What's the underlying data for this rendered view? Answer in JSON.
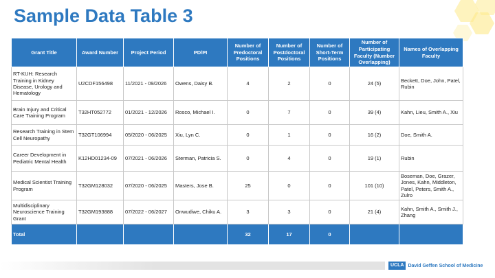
{
  "title": "Sample Data Table 3",
  "table": {
    "headers": [
      "Grant Title",
      "Award Number",
      "Project Period",
      "PD/PI",
      "Number of Predoctoral Positions",
      "Number of Postdoctoral Positions",
      "Number of Short-Term Positions",
      "Number of Participating Faculty (Number Overlapping)",
      "Names of Overlapping Faculty"
    ],
    "rows": [
      [
        "RT-KUH: Research Training in Kidney Disease, Urology and Hematology",
        "U2CDF156498",
        "11/2021 - 09/2026",
        "Owens, Daisy B.",
        "4",
        "2",
        "0",
        "24 (5)",
        "Beckett, Doe, John, Patel, Rubin"
      ],
      [
        "Brain Injury and Critical Care Training Program",
        "T32HT052772",
        "01/2021 - 12/2026",
        "Rosco, Michael I.",
        "0",
        "7",
        "0",
        "39 (4)",
        "Kahn, Lieu, Smith A., Xiu"
      ],
      [
        "Research Training in Stem Cell Neuropathy",
        "T32GT106994",
        "05/2020 - 06/2025",
        "Xiu, Lyn C.",
        "0",
        "1",
        "0",
        "16 (2)",
        "Doe, Smith A."
      ],
      [
        "Career Development in Pediatric Mental Health",
        "K12HD01234-09",
        "07/2021 - 06/2026",
        "Sterman, Patricia S.",
        "0",
        "4",
        "0",
        "19 (1)",
        "Rubin"
      ],
      [
        "Medical Scientist Training Program",
        "T32GM128032",
        "07/2020 - 06/2025",
        "Masters, Jose B.",
        "25",
        "0",
        "0",
        "101 (10)",
        "Boseman, Doe, Grazer, Jones, Kahn, Middleton, Patel, Peters, Smith A., Zulro"
      ],
      [
        "Multidisciplinary Neuroscience Training Grant",
        "T32GM193888",
        "07/2022 - 06/2027",
        "Onwudiwe, Chiku A.",
        "3",
        "3",
        "0",
        "21 (4)",
        "Kahn, Smith A., Smith J., Zhang"
      ]
    ],
    "total": {
      "label": "Total",
      "predoctoral": "32",
      "postdoctoral": "17",
      "short_term": "0"
    }
  },
  "footer": {
    "logo": "UCLA",
    "school": "David Geffen School of Medicine"
  },
  "colors": {
    "accent": "#2e79c0",
    "hexagon": "#fde98a"
  }
}
